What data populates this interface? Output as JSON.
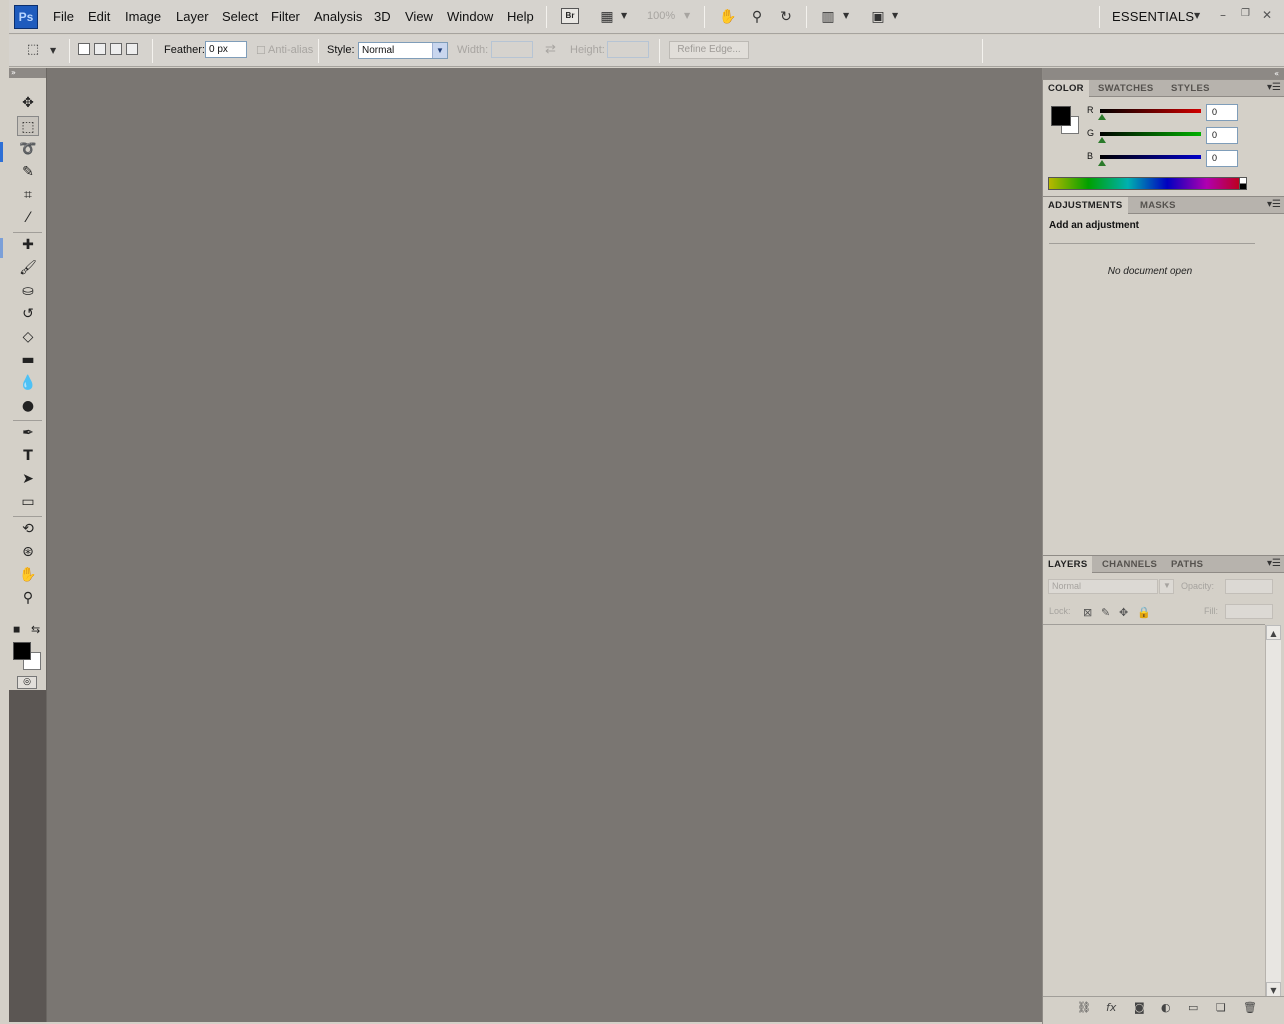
{
  "app": {
    "logo": "Ps"
  },
  "menubar": {
    "items": [
      "File",
      "Edit",
      "Image",
      "Layer",
      "Select",
      "Filter",
      "Analysis",
      "3D",
      "View",
      "Window",
      "Help"
    ],
    "bridge_label": "Br",
    "zoom": "100%",
    "workspace": "ESSENTIALS"
  },
  "options": {
    "feather_label": "Feather:",
    "feather_value": "0 px",
    "antialias_label": "Anti-alias",
    "style_label": "Style:",
    "style_value": "Normal",
    "width_label": "Width:",
    "height_label": "Height:",
    "refine_label": "Refine Edge..."
  },
  "color_panel": {
    "tabs": [
      "COLOR",
      "SWATCHES",
      "STYLES"
    ],
    "channels": [
      {
        "label": "R",
        "value": "0",
        "color": "#d00000"
      },
      {
        "label": "G",
        "value": "0",
        "color": "#00b000"
      },
      {
        "label": "B",
        "value": "0",
        "color": "#0000c8"
      }
    ],
    "foreground": "#000000",
    "background": "#ffffff"
  },
  "adjustments_panel": {
    "tabs": [
      "ADJUSTMENTS",
      "MASKS"
    ],
    "title": "Add an adjustment",
    "empty_message": "No document open"
  },
  "layers_panel": {
    "tabs": [
      "LAYERS",
      "CHANNELS",
      "PATHS"
    ],
    "blend_mode": "Normal",
    "opacity_label": "Opacity:",
    "lock_label": "Lock:",
    "fill_label": "Fill:"
  },
  "icons": {
    "tools": [
      "move-icon",
      "marquee-icon",
      "lasso-icon",
      "quick-select-icon",
      "crop-icon",
      "eyedropper-icon",
      "healing-brush-icon",
      "brush-icon",
      "clone-stamp-icon",
      "history-brush-icon",
      "eraser-icon",
      "gradient-icon",
      "blur-icon",
      "dodge-icon",
      "pen-icon",
      "type-icon",
      "path-select-icon",
      "rectangle-icon",
      "3d-rotate-icon",
      "3d-orbit-icon",
      "hand-icon",
      "zoom-icon"
    ]
  }
}
